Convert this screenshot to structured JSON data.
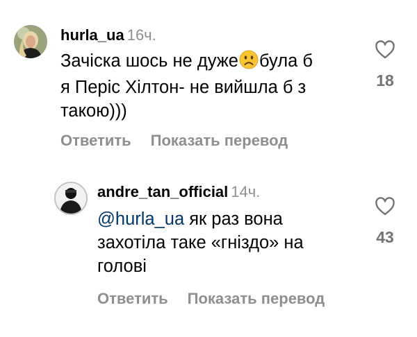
{
  "comments": [
    {
      "username": "hurla_ua",
      "time": "16ч.",
      "text_part1": "Зачіска шось не дуже",
      "emoji": "frowning-face",
      "text_part2": "була б",
      "text_line2": "я Періс Хілтон- не вийшла б з",
      "text_line3": "такою)))",
      "reply_label": "Ответить",
      "translate_label": "Показать перевод",
      "likes": "18"
    },
    {
      "username": "andre_tan_official",
      "time": "14ч.",
      "mention": "@hurla_ua",
      "text_line1": " як раз вона",
      "text_line2": "захотіла таке «гніздо» на",
      "text_line3": "голові",
      "reply_label": "Ответить",
      "translate_label": "Показать перевод",
      "likes": "43"
    }
  ]
}
